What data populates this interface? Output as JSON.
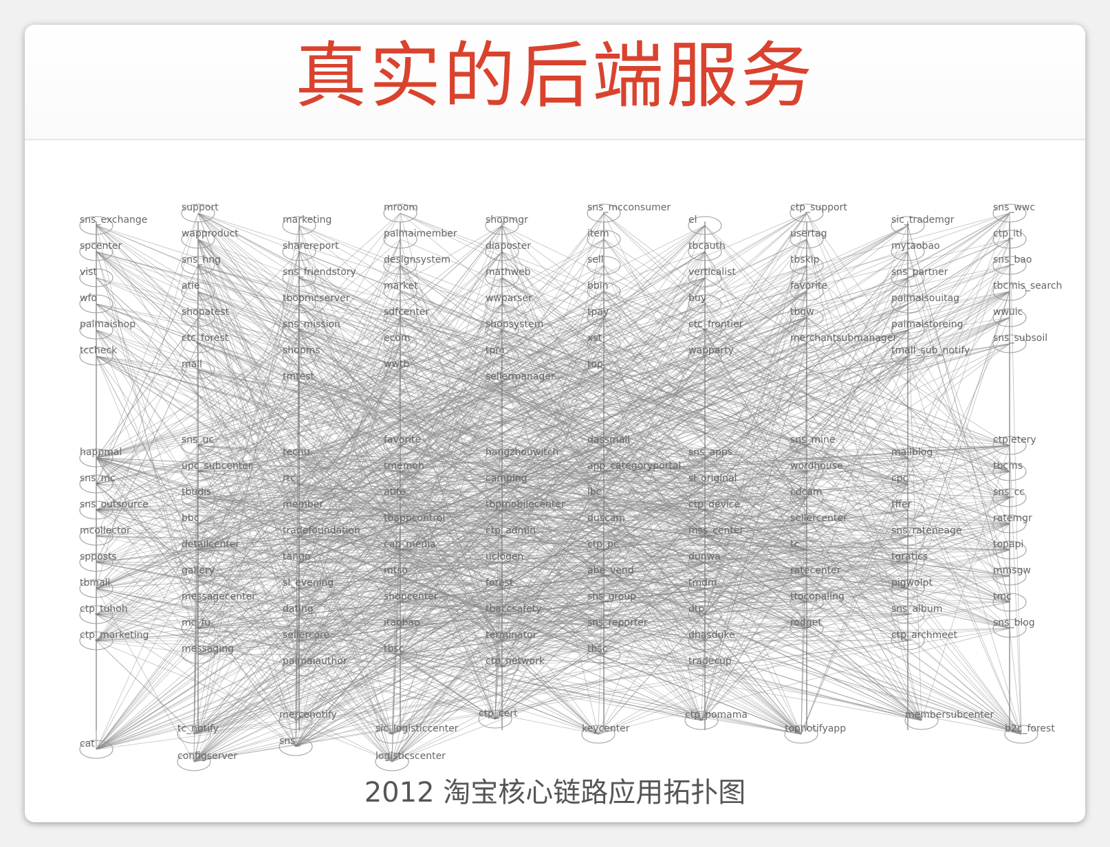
{
  "slide": {
    "title": "真实的后端服务",
    "caption": "2012 淘宝核心链路应用拓扑图"
  },
  "colors": {
    "title": "#d9432e",
    "edge": "#8a8a8a",
    "node_stroke": "#9a9a9a",
    "node_label": "#666666",
    "caption": "#555555"
  },
  "diagram": {
    "columns": [
      [
        "sns_exchange",
        "spcenter",
        "vist",
        "wfo",
        "paimaishop",
        "tccheck"
      ],
      [
        "support",
        "wapproduct",
        "sns_hng",
        "atie",
        "shopatest",
        "ctc_forest",
        "mall"
      ],
      [
        "marketing",
        "sharereport",
        "sns_friendstory",
        "tbopmcserver",
        "sns_mission",
        "shopms",
        "tmtest"
      ],
      [
        "mroom",
        "paimaimember",
        "designsystem",
        "market",
        "sdfcenter",
        "ecom",
        "wwtb"
      ],
      [
        "shopmgr",
        "diaposter",
        "mathweb",
        "wwparser",
        "shopsystem",
        "tpm",
        "sellermanager"
      ],
      [
        "sns_mcconsumer",
        "item",
        "sell",
        "bbin",
        "tpay",
        "xst",
        "top"
      ],
      [
        "el",
        "tbcauth",
        "verticalist",
        "buy",
        "ctc_frontier",
        "wapparty"
      ],
      [
        "ctp_support",
        "usertag",
        "tbskip",
        "favorite",
        "tbgw",
        "merchantsubmanager"
      ],
      [
        "sic_trademgr",
        "mytaobao",
        "sns_partner",
        "paimaisouitag",
        "paimaistoreing",
        "tmall_sub_notify"
      ],
      [
        "sns_wwc",
        "ctp_itl",
        "sns_bao",
        "tbcmis_search",
        "wwuic",
        "sns_subsoil"
      ]
    ],
    "middle_columns": [
      [
        "happmal",
        "sns_mc",
        "sns_outsource",
        "mcollector",
        "spposts",
        "tbmall",
        "ctp_tuhoh",
        "ctp_marketing"
      ],
      [
        "sns_uc",
        "upc_subcenter",
        "tbudis",
        "bbc",
        "detailcenter",
        "gallery",
        "messagecenter",
        "mc_fu",
        "messaging"
      ],
      [
        "tecnu",
        "rtc",
        "member",
        "tradefoundation",
        "tango",
        "sl_evening",
        "dating",
        "sellercore",
        "paimaiauthor"
      ],
      [
        "favorite",
        "tmemoh",
        "atite",
        "tbappcontrol",
        "cap_media",
        "mtso",
        "shopcenter",
        "itaobao",
        "tbsc"
      ],
      [
        "hangzhouwitch",
        "camping",
        "tbpmobilecenter",
        "ctp_admin",
        "uclogen",
        "forest",
        "tbaccsafety",
        "terminator",
        "ctp_network"
      ],
      [
        "dassmall",
        "app_categoryportal",
        "lbc",
        "duscam",
        "ctp_pc",
        "abe_vend",
        "sns_group",
        "sns_reporter",
        "tbsc"
      ],
      [
        "sns_apps",
        "sl_original",
        "ctp_device",
        "mss_center",
        "dunwa",
        "tmdm",
        "dtp",
        "dhasduke",
        "tradecup"
      ],
      [
        "sns_mine",
        "wordhouse",
        "cdcam",
        "sellercenter",
        "tc",
        "ratecenter",
        "ttocopaling",
        "rodget"
      ],
      [
        "mailblog",
        "cpc",
        "tffer",
        "sns_rateneage",
        "tgratics",
        "pigwolpt",
        "sns_album",
        "ctp_archmeet"
      ],
      [
        "ctpletery",
        "tbcms",
        "sns_cc",
        "ratemgr",
        "topapi",
        "mmsgw",
        "tmc",
        "sns_blog"
      ]
    ],
    "bottom_nodes": [
      "cat",
      "tc_notify",
      "configserver",
      "mercenotify",
      "sns_",
      "sic_logisticcenter",
      "logisticscenter",
      "ctp_cert",
      "keycenter",
      "ctp_pomama",
      "topnotifyapp",
      "membersubcenter",
      "b2c_forest"
    ]
  }
}
